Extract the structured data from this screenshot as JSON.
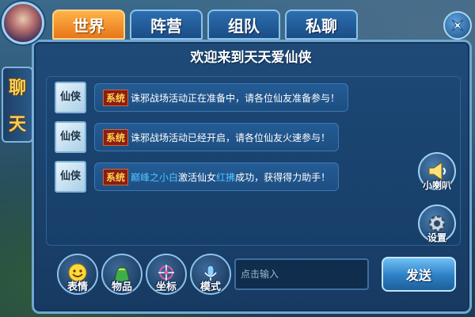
{
  "tabs": [
    {
      "label": "世界",
      "active": true
    },
    {
      "label": "阵营",
      "active": false
    },
    {
      "label": "组队",
      "active": false
    },
    {
      "label": "私聊",
      "active": false
    }
  ],
  "side_strip": {
    "chars": [
      "聊",
      "天"
    ]
  },
  "title": "欢迎来到天天爱仙侠",
  "messages": [
    {
      "avatar_text": "仙侠",
      "tag": "系统",
      "text": "诛邪战场活动正在准备中，请各位仙友准备参与！"
    },
    {
      "avatar_text": "仙侠",
      "tag": "系统",
      "text": "诛邪战场活动已经开启，请各位仙友火速参与！"
    },
    {
      "avatar_text": "仙侠",
      "tag": "系统",
      "name": "巅峰之小白",
      "text_mid": "激活仙女",
      "item": "红拂",
      "text_end": "成功，获得得力助手！"
    }
  ],
  "right_buttons": {
    "speaker_label": "小喇叭",
    "settings_label": "设置"
  },
  "bottom": {
    "emoji_label": "表情",
    "items_label": "物品",
    "coords_label": "坐标",
    "mode_label": "模式",
    "input_placeholder": "点击输入",
    "send_label": "发送"
  },
  "colors": {
    "active_tab": "#e8761a",
    "system_tag_bg": "#8a1e14",
    "system_tag_text": "#ffd24a",
    "player_name": "#4fc3ff"
  },
  "icons": {
    "close": "close-icon",
    "speaker": "speaker-icon",
    "settings": "gear-icon",
    "emoji": "smiley-icon",
    "items": "bag-icon",
    "coords": "location-icon",
    "mode": "microphone-icon"
  }
}
